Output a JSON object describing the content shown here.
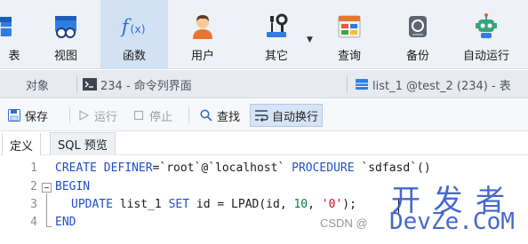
{
  "toolbar": {
    "items": [
      {
        "label": "表",
        "icon": "table-icon"
      },
      {
        "label": "视图",
        "icon": "view-icon"
      },
      {
        "label": "函数",
        "icon": "function-icon",
        "active": true
      },
      {
        "label": "用户",
        "icon": "user-icon"
      },
      {
        "label": "其它",
        "icon": "tools-icon"
      },
      {
        "label": "查询",
        "icon": "query-icon"
      },
      {
        "label": "备份",
        "icon": "backup-icon"
      },
      {
        "label": "自动运行",
        "icon": "robot-icon"
      }
    ]
  },
  "tabs": {
    "objects": "对象",
    "console": "234 - 命令列界面",
    "editor": "list_1 @test_2 (234) - 表"
  },
  "edit_toolbar": {
    "save": "保存",
    "run": "运行",
    "stop": "停止",
    "find": "查找",
    "wrap": "自动换行"
  },
  "sub_tabs": {
    "definition": "定义",
    "sql_preview": "SQL 预览"
  },
  "code": {
    "line_numbers": [
      "1",
      "2",
      "3",
      "4"
    ],
    "l1_kw1": "CREATE DEFINER",
    "l1_eq": "=",
    "l1_user": "`root`@`localhost`",
    "l1_kw2": "PROCEDURE",
    "l1_name": "`sdfasd`()",
    "l2_kw": "BEGIN",
    "l3_kw1": "UPDATE",
    "l3_t1": "list_1",
    "l3_kw2": "SET",
    "l3_t2": "id = LPAD(id, ",
    "l3_num": "10",
    "l3_comma": ", ",
    "l3_str": "'0'",
    "l3_end": ");",
    "l4_kw": "END"
  },
  "watermark": {
    "big": "开 发 者",
    "sub": "DevZe.CoM",
    "csdn": "CSDN @"
  },
  "colors": {
    "keyword": "#1f4fcf",
    "number": "#0a7d3e",
    "string": "#c8102e",
    "toolbar_bg": "#eef1f6",
    "active_bg": "#d3e1f4"
  }
}
